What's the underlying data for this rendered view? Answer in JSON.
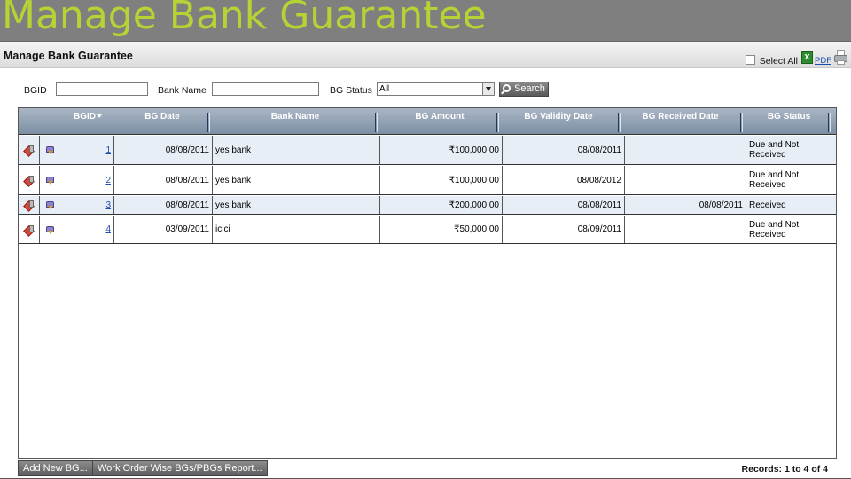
{
  "slide": {
    "title": "Manage Bank Guarantee"
  },
  "header": {
    "title": "Manage Bank Guarantee",
    "select_all_label": "Select All",
    "pdf_label": "PDF"
  },
  "filters": {
    "bgid_label": "BGID",
    "bgid_value": "",
    "bank_name_label": "Bank Name",
    "bank_name_value": "",
    "status_label": "BG Status",
    "status_value": "All",
    "search_label": "Search"
  },
  "grid": {
    "columns": [
      "BGID",
      "BG Date",
      "Bank Name",
      "BG Amount",
      "BG Validity Date",
      "BG Received Date",
      "BG Status"
    ],
    "rows": [
      {
        "bgid": "1",
        "bg_date": "08/08/2011",
        "bank_name": "yes bank",
        "amount": "₹100,000.00",
        "validity": "08/08/2011",
        "received": "",
        "status": "Due and Not Received"
      },
      {
        "bgid": "2",
        "bg_date": "08/08/2011",
        "bank_name": "yes bank",
        "amount": "₹100,000.00",
        "validity": "08/08/2012",
        "received": "",
        "status": "Due and Not Received"
      },
      {
        "bgid": "3",
        "bg_date": "08/08/2011",
        "bank_name": "yes bank",
        "amount": "₹200,000.00",
        "validity": "08/08/2011",
        "received": "08/08/2011",
        "status": "Received"
      },
      {
        "bgid": "4",
        "bg_date": "03/09/2011",
        "bank_name": "icici",
        "amount": "₹50,000.00",
        "validity": "08/09/2011",
        "received": "",
        "status": "Due and Not Received"
      }
    ]
  },
  "footer": {
    "add_button": "Add New BG...",
    "report_button": "Work Order Wise BGs/PBGs Report...",
    "records": "Records: 1 to 4 of 4"
  },
  "colors": {
    "title_green": "#b5d334",
    "header_blue": "#7d8fa4",
    "link_blue": "#1a4fb0"
  }
}
